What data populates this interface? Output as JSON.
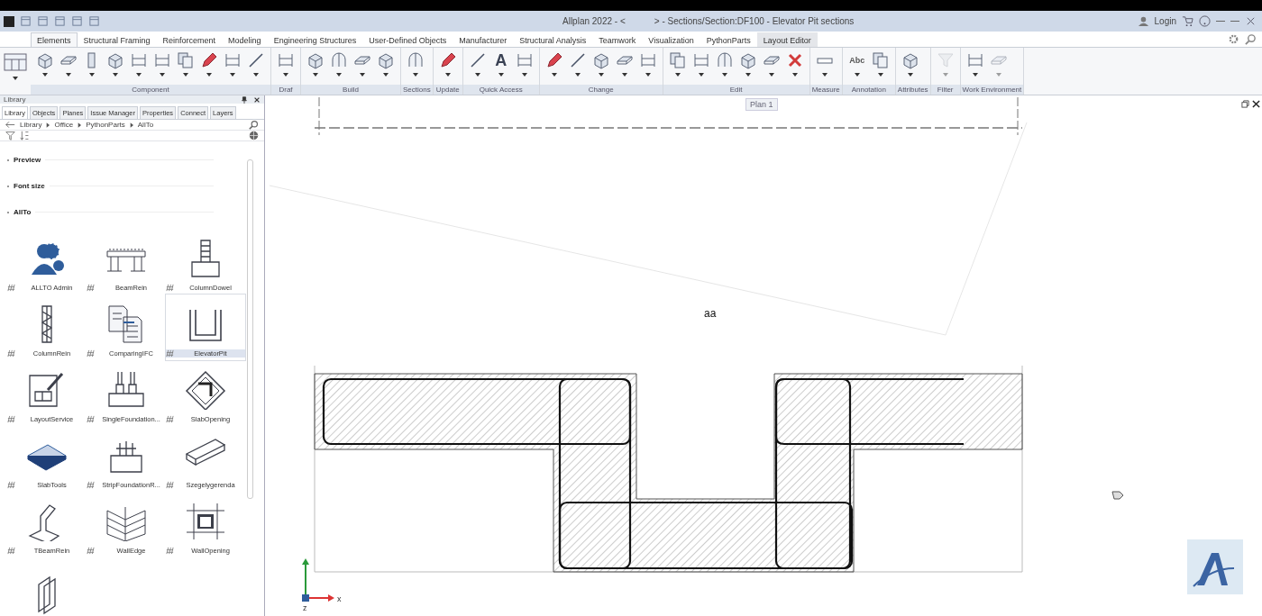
{
  "window": {
    "title_left": "Allplan 2022 - <",
    "title_right": "> - Sections/Section:DF100 - Elevator Pit sections",
    "login": "Login"
  },
  "ribbon_tabs": [
    {
      "label": "Elements",
      "selected": true,
      "contextual": false
    },
    {
      "label": "Structural Framing",
      "selected": false,
      "contextual": false
    },
    {
      "label": "Reinforcement",
      "selected": false,
      "contextual": false
    },
    {
      "label": "Modeling",
      "selected": false,
      "contextual": false
    },
    {
      "label": "Engineering Structures",
      "selected": false,
      "contextual": false
    },
    {
      "label": "User-Defined Objects",
      "selected": false,
      "contextual": false
    },
    {
      "label": "Manufacturer",
      "selected": false,
      "contextual": false
    },
    {
      "label": "Structural Analysis",
      "selected": false,
      "contextual": false
    },
    {
      "label": "Teamwork",
      "selected": false,
      "contextual": false
    },
    {
      "label": "Visualization",
      "selected": false,
      "contextual": false
    },
    {
      "label": "PythonParts",
      "selected": false,
      "contextual": false
    },
    {
      "label": "Layout Editor",
      "selected": false,
      "contextual": true
    }
  ],
  "ribbon_groups": [
    {
      "label": "Component",
      "tools": [
        {
          "kind": "box",
          "disabled": false
        },
        {
          "kind": "slab",
          "disabled": false
        },
        {
          "kind": "column",
          "disabled": false
        },
        {
          "kind": "box",
          "disabled": false
        },
        {
          "kind": "frame",
          "disabled": false
        },
        {
          "kind": "frame",
          "disabled": false
        },
        {
          "kind": "stack",
          "disabled": false
        },
        {
          "kind": "pencil",
          "disabled": false
        },
        {
          "kind": "frame",
          "disabled": false
        },
        {
          "kind": "line",
          "disabled": false
        }
      ]
    },
    {
      "label": "Draf",
      "tools": [
        {
          "kind": "frame",
          "disabled": false
        }
      ]
    },
    {
      "label": "Build",
      "tools": [
        {
          "kind": "box",
          "disabled": false
        },
        {
          "kind": "arch",
          "disabled": false
        },
        {
          "kind": "slab",
          "disabled": false
        },
        {
          "kind": "box",
          "disabled": false
        }
      ]
    },
    {
      "label": "Sections",
      "tools": [
        {
          "kind": "arch",
          "disabled": false
        }
      ]
    },
    {
      "label": "Update",
      "tools": [
        {
          "kind": "pencil",
          "disabled": false
        }
      ]
    },
    {
      "label": "Quick Access",
      "tools": [
        {
          "kind": "line",
          "disabled": false
        },
        {
          "kind": "glyph",
          "glyph": "A",
          "disabled": false
        },
        {
          "kind": "frame",
          "disabled": false
        }
      ]
    },
    {
      "label": "Change",
      "tools": [
        {
          "kind": "pencil",
          "disabled": false
        },
        {
          "kind": "line",
          "disabled": false
        },
        {
          "kind": "box",
          "disabled": false
        },
        {
          "kind": "slab",
          "disabled": false
        },
        {
          "kind": "frame",
          "disabled": false
        }
      ]
    },
    {
      "label": "Edit",
      "tools": [
        {
          "kind": "stack",
          "disabled": false
        },
        {
          "kind": "frame",
          "disabled": false
        },
        {
          "kind": "arch",
          "disabled": false
        },
        {
          "kind": "box",
          "disabled": false
        },
        {
          "kind": "slab",
          "disabled": false
        },
        {
          "kind": "delete",
          "disabled": false
        }
      ]
    },
    {
      "label": "Measure",
      "tools": [
        {
          "kind": "ruler",
          "disabled": false
        }
      ]
    },
    {
      "label": "Annotation",
      "tools": [
        {
          "kind": "glyph",
          "glyph": "Abc",
          "disabled": false
        },
        {
          "kind": "stack",
          "disabled": false
        }
      ]
    },
    {
      "label": "Attributes",
      "tools": [
        {
          "kind": "box",
          "disabled": false
        }
      ]
    },
    {
      "label": "Filter",
      "tools": [
        {
          "kind": "funnel",
          "disabled": true
        }
      ]
    },
    {
      "label": "Work Environment",
      "tools": [
        {
          "kind": "frame",
          "disabled": false
        },
        {
          "kind": "slab",
          "disabled": true
        }
      ]
    }
  ],
  "library": {
    "title": "Library",
    "tabs": [
      {
        "label": "Library",
        "selected": true
      },
      {
        "label": "Objects",
        "selected": false
      },
      {
        "label": "Planes",
        "selected": false
      },
      {
        "label": "Issue Manager",
        "selected": false
      },
      {
        "label": "Properties",
        "selected": false
      },
      {
        "label": "Connect",
        "selected": false
      },
      {
        "label": "Layers",
        "selected": false
      }
    ],
    "breadcrumb": [
      "Library",
      "Office",
      "PythonParts",
      "AllTo"
    ],
    "sections": [
      {
        "label": "Preview"
      },
      {
        "label": "Font size"
      },
      {
        "label": "AllTo"
      }
    ],
    "items": [
      {
        "label": "ALLTO Admin",
        "kind": "users",
        "selected": false
      },
      {
        "label": "BeamRein",
        "kind": "beam",
        "selected": false
      },
      {
        "label": "ColumnDowel",
        "kind": "dowel",
        "selected": false
      },
      {
        "label": "ColumnRein",
        "kind": "cage",
        "selected": false
      },
      {
        "label": "ComparingIFC",
        "kind": "docs",
        "selected": false
      },
      {
        "label": "ElevatorPit",
        "kind": "pit",
        "selected": true
      },
      {
        "label": "LayoutService",
        "kind": "layout",
        "selected": false
      },
      {
        "label": "SingleFoundation...",
        "kind": "foundation",
        "selected": false
      },
      {
        "label": "SlabOpening",
        "kind": "diamond",
        "selected": false
      },
      {
        "label": "SlabTools",
        "kind": "slab",
        "selected": false
      },
      {
        "label": "StripFoundationR...",
        "kind": "strip",
        "selected": false
      },
      {
        "label": "Szegelygerenda",
        "kind": "ibeam",
        "selected": false
      },
      {
        "label": "TBeamRein",
        "kind": "tbeam",
        "selected": false
      },
      {
        "label": "WallEdge",
        "kind": "walledge",
        "selected": false
      },
      {
        "label": "WallOpening",
        "kind": "opening",
        "selected": false
      },
      {
        "kind": "wall",
        "selected": false
      }
    ]
  },
  "canvas": {
    "section_label": "aa",
    "plan_tag": "Plan 1",
    "axis_x": "x",
    "axis_z": "z"
  }
}
